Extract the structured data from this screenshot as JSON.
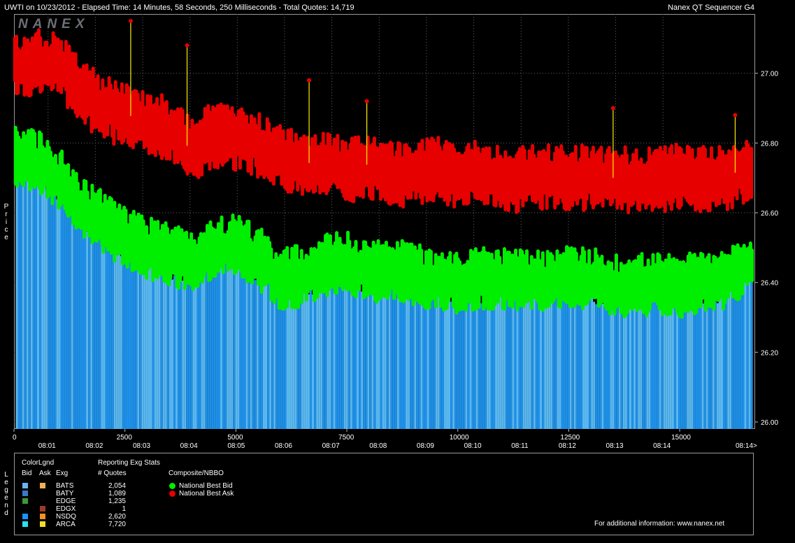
{
  "header": {
    "title_left": "UWTI on 10/23/2012  -  Elapsed Time: 14 Minutes, 58 Seconds, 250 Milliseconds  -  Total Quotes: 14,719",
    "title_right": "Nanex QT Sequencer G4",
    "watermark": "NANEX"
  },
  "axis": {
    "y_label": "Price",
    "y_ticks": [
      "26.00",
      "26.20",
      "26.40",
      "26.60",
      "26.80",
      "27.00"
    ],
    "x_count_ticks": [
      "0",
      "2500",
      "5000",
      "7500",
      "10000",
      "12500",
      "15000"
    ],
    "x_time_ticks": [
      "08:01",
      "08:02",
      "08:03",
      "08:04",
      "08:05",
      "08:06",
      "08:07",
      "08:08",
      "08:09",
      "08:10",
      "08:11",
      "08:12",
      "08:13",
      "08:14",
      "08:14>"
    ]
  },
  "colors": {
    "ask": "#e60000",
    "bid": "#00ee00",
    "bid_bar": "#1e90e8",
    "bid_bar_light": "#5ab8f0",
    "spike": "#ffee00",
    "background": "#000000",
    "grid": "#666666"
  },
  "chart_data": {
    "type": "scatter",
    "title": "UWTI on 10/23/2012  -  Elapsed Time: 14 Minutes, 58 Seconds, 250 Milliseconds  -  Total Quotes: 14,719",
    "xlabel": "",
    "ylabel": "Price",
    "xlim": [
      0,
      16700
    ],
    "ylim": [
      25.98,
      27.17
    ],
    "grid": true,
    "legend_position": "bottom",
    "series": [
      {
        "name": "National Best Ask",
        "color": "#e60000",
        "x": [
          0,
          500,
          1000,
          1500,
          2000,
          2500,
          3000,
          3500,
          4000,
          4500,
          5000,
          5500,
          6000,
          6500,
          7000,
          7500,
          8000,
          8500,
          9000,
          9500,
          10000,
          10500,
          11000,
          11500,
          12000,
          12500,
          13000,
          13500,
          14000,
          14500,
          15000,
          15500,
          16000,
          16500
        ],
        "y": [
          27.02,
          27.04,
          27.03,
          26.95,
          26.91,
          26.88,
          26.87,
          26.84,
          26.78,
          26.83,
          26.82,
          26.8,
          26.76,
          26.74,
          26.75,
          26.72,
          26.74,
          26.72,
          26.71,
          26.73,
          26.71,
          26.72,
          26.7,
          26.7,
          26.71,
          26.7,
          26.71,
          26.7,
          26.7,
          26.7,
          26.71,
          26.7,
          26.7,
          26.73
        ]
      },
      {
        "name": "National Best Bid",
        "color": "#00ee00",
        "x": [
          0,
          500,
          1000,
          1500,
          2000,
          2500,
          3000,
          3500,
          4000,
          4500,
          5000,
          5500,
          6000,
          6500,
          7000,
          7500,
          8000,
          8500,
          9000,
          9500,
          10000,
          10500,
          11000,
          11500,
          12000,
          12500,
          13000,
          13500,
          14000,
          14500,
          15000,
          15500,
          16000,
          16500
        ],
        "y": [
          26.75,
          26.74,
          26.69,
          26.61,
          26.56,
          26.52,
          26.49,
          26.47,
          26.45,
          26.49,
          26.5,
          26.46,
          26.4,
          26.41,
          26.44,
          26.45,
          26.42,
          26.43,
          26.41,
          26.4,
          26.39,
          26.4,
          26.4,
          26.4,
          26.39,
          26.41,
          26.4,
          26.38,
          26.38,
          26.39,
          26.38,
          26.39,
          26.4,
          26.45
        ]
      }
    ]
  },
  "legend": {
    "side_label": "Legend",
    "colorlgnd_title": "ColorLgnd",
    "col_bid": "Bid",
    "col_ask": "Ask",
    "col_exg": "Exg",
    "stats_title": "Reporting Exg Stats",
    "stats_sub": "# Quotes",
    "nbbo_title": "Composite/NBBO",
    "exchanges": [
      {
        "name": "BATS",
        "quotes": "2,054",
        "bid_color": "#6ab4f0",
        "ask_color": "#f0b050"
      },
      {
        "name": "BATY",
        "quotes": "1,089",
        "bid_color": "#3c78c8",
        "ask_color": ""
      },
      {
        "name": "EDGE",
        "quotes": "1,235",
        "bid_color": "#3a9a3a",
        "ask_color": ""
      },
      {
        "name": "EDGX",
        "quotes": "1",
        "bid_color": "",
        "ask_color": "#9a3c28"
      },
      {
        "name": "NSDQ",
        "quotes": "2,620",
        "bid_color": "#1e90ff",
        "ask_color": "#f09028"
      },
      {
        "name": "ARCA",
        "quotes": "7,720",
        "bid_color": "#28e0f0",
        "ask_color": "#f0e020"
      }
    ],
    "nbbo": [
      {
        "label": "National Best Bid",
        "color": "#00ee00"
      },
      {
        "label": "National Best Ask",
        "color": "#e60000"
      }
    ],
    "footer": "For additional information: www.nanex.net"
  }
}
